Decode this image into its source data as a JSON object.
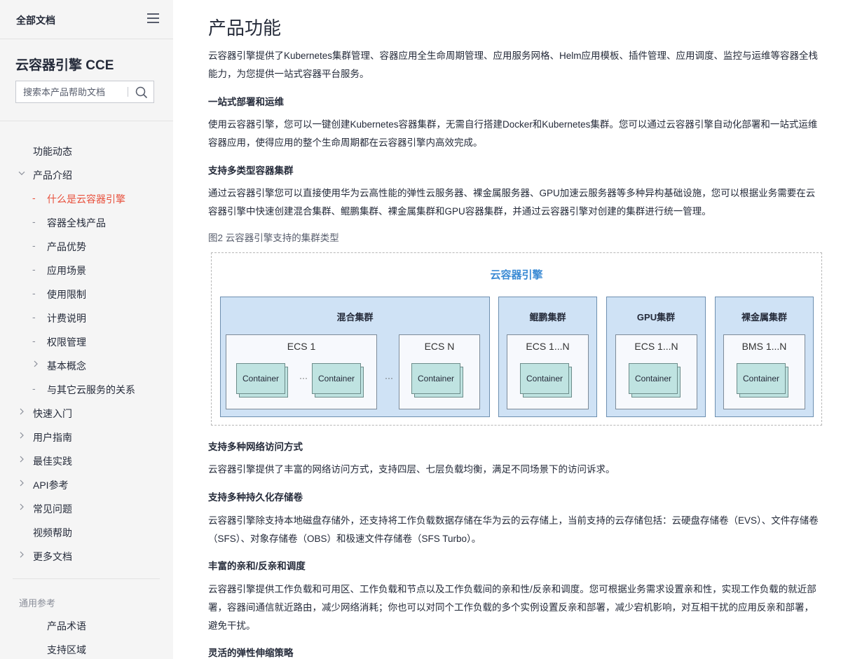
{
  "sidebar": {
    "all_docs": "全部文档",
    "product_name": "云容器引擎 CCE",
    "search_placeholder": "搜索本产品帮助文档",
    "items": [
      {
        "label": "功能动态"
      },
      {
        "label": "产品介绍"
      },
      {
        "label": "什么是云容器引擎"
      },
      {
        "label": "容器全栈产品"
      },
      {
        "label": "产品优势"
      },
      {
        "label": "应用场景"
      },
      {
        "label": "使用限制"
      },
      {
        "label": "计费说明"
      },
      {
        "label": "权限管理"
      },
      {
        "label": "基本概念"
      },
      {
        "label": "与其它云服务的关系"
      },
      {
        "label": "快速入门"
      },
      {
        "label": "用户指南"
      },
      {
        "label": "最佳实践"
      },
      {
        "label": "API参考"
      },
      {
        "label": "常见问题"
      },
      {
        "label": "视频帮助"
      },
      {
        "label": "更多文档"
      }
    ],
    "ref_title": "通用参考",
    "ref_items": [
      {
        "label": "产品术语"
      },
      {
        "label": "支持区域"
      }
    ]
  },
  "main": {
    "title": "产品功能",
    "intro": "云容器引擎提供了Kubernetes集群管理、容器应用全生命周期管理、应用服务网格、Helm应用模板、插件管理、应用调度、监控与运维等容器全栈能力，为您提供一站式容器平台服务。",
    "sections": [
      {
        "heading": "一站式部署和运维",
        "text": "使用云容器引擎，您可以一键创建Kubernetes容器集群，无需自行搭建Docker和Kubernetes集群。您可以通过云容器引擎自动化部署和一站式运维容器应用，使得应用的整个生命周期都在云容器引擎内高效完成。"
      },
      {
        "heading": "支持多类型容器集群",
        "text": "通过云容器引擎您可以直接使用华为云高性能的弹性云服务器、裸金属服务器、GPU加速云服务器等多种异构基础设施，您可以根据业务需要在云容器引擎中快速创建混合集群、鲲鹏集群、裸金属集群和GPU容器集群，并通过云容器引擎对创建的集群进行统一管理。"
      },
      {
        "heading": "支持多种网络访问方式",
        "text": "云容器引擎提供了丰富的网络访问方式，支持四层、七层负载均衡，满足不同场景下的访问诉求。"
      },
      {
        "heading": "支持多种持久化存储卷",
        "text": "云容器引擎除支持本地磁盘存储外，还支持将工作负载数据存储在华为云的云存储上，当前支持的云存储包括：云硬盘存储卷（EVS）、文件存储卷（SFS）、对象存储卷（OBS）和极速文件存储卷（SFS Turbo）。"
      },
      {
        "heading": "丰富的亲和/反亲和调度",
        "text": "云容器引擎提供工作负载和可用区、工作负载和节点以及工作负载间的亲和性/反亲和调度。您可根据业务需求设置亲和性，实现工作负载的就近部署，容器间通信就近路由，减少网络消耗；你也可以对同个工作负载的多个实例设置反亲和部署，减少宕机影响，对互相干扰的应用反亲和部署，避免干扰。"
      },
      {
        "heading": "灵活的弹性伸缩策略"
      }
    ],
    "figure": {
      "caption": "图2 云容器引擎支持的集群类型",
      "title": "云容器引擎",
      "container_label": "Container",
      "ellipsis": "···",
      "clusters": [
        {
          "name": "混合集群",
          "nodes": [
            "ECS 1",
            "ECS N"
          ]
        },
        {
          "name": "鲲鹏集群",
          "nodes": [
            "ECS 1...N"
          ]
        },
        {
          "name": "GPU集群",
          "nodes": [
            "ECS 1...N"
          ]
        },
        {
          "name": "裸金属集群",
          "nodes": [
            "BMS 1...N"
          ]
        }
      ]
    }
  }
}
